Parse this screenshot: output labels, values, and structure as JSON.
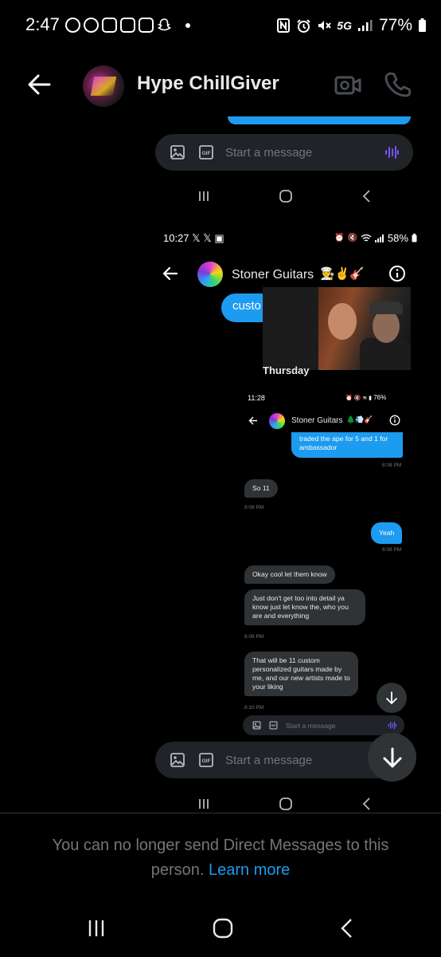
{
  "status_bar": {
    "time": "2:47",
    "network": "5G",
    "battery": "77%"
  },
  "header": {
    "title": "Hype ChillGiver",
    "back_icon": "arrow-left-icon",
    "video_icon": "video-camera-icon",
    "call_icon": "phone-icon"
  },
  "screenshot": {
    "composer_placeholder": "Start a message",
    "inner_status": {
      "time": "10:27 𝕏 𝕏 ▣",
      "battery": "58%"
    },
    "inner_header": {
      "title": "Stoner Guitars",
      "emoji": "👨‍🍳✌️🎸"
    },
    "partial_bubble": "custo",
    "day_label": "Thursday",
    "innermost_status": {
      "time": "11:28",
      "battery": "76%"
    },
    "innermost_header": {
      "title": "Stoner Guitars",
      "emoji": "🌲💨🎸"
    },
    "messages": [
      {
        "dir": "out",
        "text": "traded the ape for 5 and 1 for ambassador",
        "time": "8:08 PM"
      },
      {
        "dir": "in",
        "text": "So 11",
        "time": "8:08 PM"
      },
      {
        "dir": "out",
        "text": "Yeah",
        "time": "8:08 PM"
      },
      {
        "dir": "in",
        "text": "Okay cool let them know",
        "time": ""
      },
      {
        "dir": "in",
        "text": "Just don't get too into detail ya know just let know the, who you are and everything",
        "time": "8:08 PM"
      },
      {
        "dir": "in",
        "text": "That will be 11 custom personalized guitars made by me, and our new artists made to your liking",
        "time": "8:10 PM"
      }
    ]
  },
  "notice": {
    "text": "You can no longer send Direct Messages to this person.",
    "link": "Learn more"
  },
  "colors": {
    "accent": "#1d9bf0",
    "background": "#000000",
    "bubble_in": "#2f3336",
    "muted": "#71767b"
  }
}
